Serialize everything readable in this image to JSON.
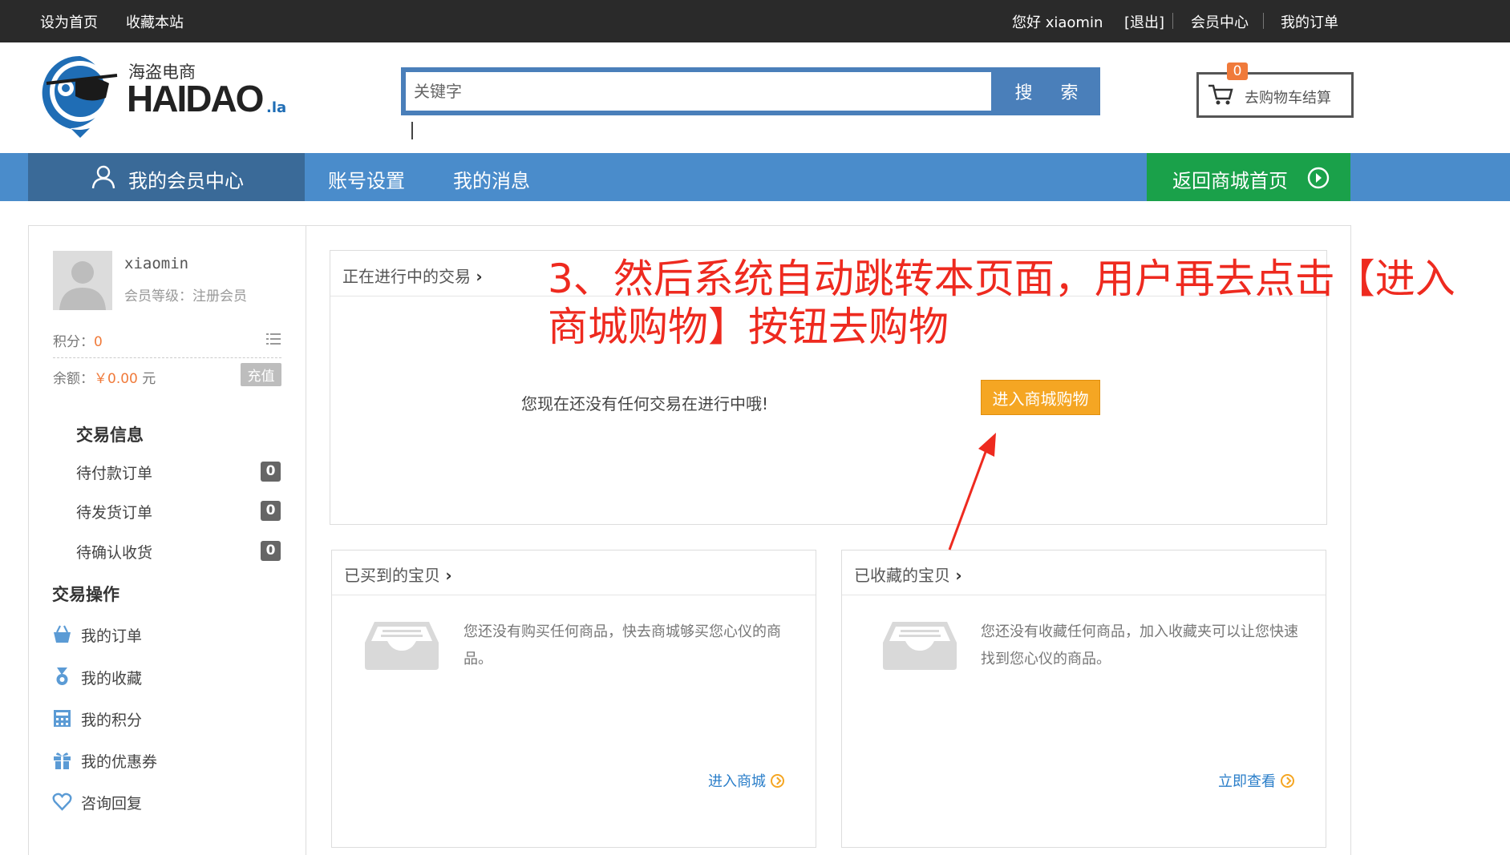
{
  "topbar": {
    "set_home": "设为首页",
    "bookmark": "收藏本站",
    "greeting": "您好 xiaomin",
    "logout": "[退出]",
    "member_center": "会员中心",
    "my_orders": "我的订单"
  },
  "logo": {
    "cn_name": "海盗电商",
    "en_name": "HAIDAO",
    "suffix": ".la"
  },
  "search": {
    "placeholder": "关键字",
    "button": "搜 索"
  },
  "cart": {
    "count": "0",
    "label": "去购物车结算"
  },
  "nav": {
    "member_center": "我的会员中心",
    "account_settings": "账号设置",
    "my_messages": "我的消息",
    "back_home": "返回商城首页"
  },
  "profile": {
    "username": "xiaomin",
    "level_label": "会员等级：注册会员",
    "points_label": "积分：",
    "points_value": "0",
    "balance_label": "余额：",
    "balance_value": "￥0.00",
    "balance_unit": "元",
    "recharge": "充值"
  },
  "trade_info": {
    "title": "交易信息",
    "items": [
      {
        "label": "待付款订单",
        "count": "0"
      },
      {
        "label": "待发货订单",
        "count": "0"
      },
      {
        "label": "待确认收货",
        "count": "0"
      }
    ]
  },
  "trade_ops": {
    "title": "交易操作",
    "items": [
      {
        "label": "我的订单",
        "icon": "basket-icon"
      },
      {
        "label": "我的收藏",
        "icon": "medal-icon"
      },
      {
        "label": "我的积分",
        "icon": "calculator-icon"
      },
      {
        "label": "我的优惠券",
        "icon": "gift-icon"
      },
      {
        "label": "咨询回复",
        "icon": "heart-icon"
      }
    ]
  },
  "ongoing": {
    "title": "正在进行中的交易",
    "empty": "您现在还没有任何交易在进行中哦!",
    "button": "进入商城购物"
  },
  "bought": {
    "title": "已买到的宝贝",
    "desc": "您还没有购买任何商品，快去商城够买您心仪的商品。",
    "link": "进入商城"
  },
  "favorites": {
    "title": "已收藏的宝贝",
    "desc": "您还没有收藏任何商品，加入收藏夹可以让您快速找到您心仪的商品。",
    "link": "立即查看"
  },
  "annotation": {
    "text": "3、然后系统自动跳转本页面，用户再去点击【进入商城购物】按钮去购物",
    "color": "#ee2a1f"
  },
  "colors": {
    "nav_blue": "#4a8ccb",
    "member_tab": "#3a6a98",
    "home_green": "#1aa14a",
    "shop_button": "#f5a623",
    "link_blue": "#2a7ec9"
  }
}
